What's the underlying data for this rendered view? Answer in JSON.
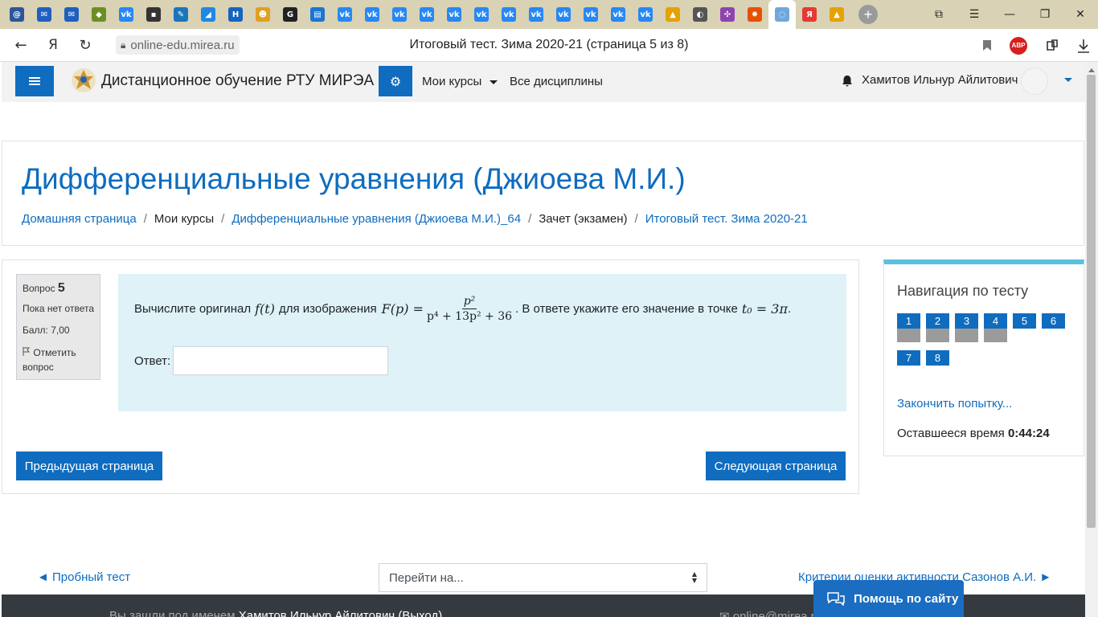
{
  "browser": {
    "tabs": [
      {
        "icon": "at-mail-icon",
        "color": "#2b579a",
        "glyph": "@"
      },
      {
        "icon": "mail-icon",
        "color": "#1f5fbf",
        "glyph": "✉"
      },
      {
        "icon": "mail-icon",
        "color": "#1f5fbf",
        "glyph": "✉"
      },
      {
        "icon": "emblem-icon",
        "color": "#6b8e23",
        "glyph": "◆"
      },
      {
        "icon": "vk-icon",
        "color": "#2787f5",
        "glyph": "vk"
      },
      {
        "icon": "app-icon",
        "color": "#333333",
        "glyph": "▪"
      },
      {
        "icon": "wrench-icon",
        "color": "#1b75bb",
        "glyph": "✎"
      },
      {
        "icon": "leaf-icon",
        "color": "#1e88e5",
        "glyph": "◢"
      },
      {
        "icon": "h-icon",
        "color": "#1565c0",
        "glyph": "H"
      },
      {
        "icon": "face-icon",
        "color": "#e0a020",
        "glyph": "☻"
      },
      {
        "icon": "g-icon",
        "color": "#222222",
        "glyph": "G"
      },
      {
        "icon": "chat-icon",
        "color": "#1976d2",
        "glyph": "▤"
      },
      {
        "icon": "vk-icon",
        "color": "#2787f5",
        "glyph": "vk"
      },
      {
        "icon": "vk-icon",
        "color": "#2787f5",
        "glyph": "vk"
      },
      {
        "icon": "vk-icon",
        "color": "#2787f5",
        "glyph": "vk"
      },
      {
        "icon": "vk-icon",
        "color": "#2787f5",
        "glyph": "vk"
      },
      {
        "icon": "vk-icon",
        "color": "#2787f5",
        "glyph": "vk"
      },
      {
        "icon": "vk-icon",
        "color": "#2787f5",
        "glyph": "vk"
      },
      {
        "icon": "vk-icon",
        "color": "#2787f5",
        "glyph": "vk"
      },
      {
        "icon": "vk-icon",
        "color": "#2787f5",
        "glyph": "vk"
      },
      {
        "icon": "vk-icon",
        "color": "#2787f5",
        "glyph": "vk"
      },
      {
        "icon": "vk-icon",
        "color": "#2787f5",
        "glyph": "vk"
      },
      {
        "icon": "vk-icon",
        "color": "#2787f5",
        "glyph": "vk"
      },
      {
        "icon": "vk-icon",
        "color": "#2787f5",
        "glyph": "vk"
      },
      {
        "icon": "image-icon",
        "color": "#e6a200",
        "glyph": "▲"
      },
      {
        "icon": "moodle-icon",
        "color": "#555555",
        "glyph": "◐"
      },
      {
        "icon": "grid-icon",
        "color": "#8e44ad",
        "glyph": "✣"
      },
      {
        "icon": "sun-icon",
        "color": "#e65100",
        "glyph": "✹"
      },
      {
        "icon": "active-tab-icon",
        "color": "#6fa8dc",
        "glyph": "◌"
      },
      {
        "icon": "yandex-icon",
        "color": "#e53935",
        "glyph": "Я"
      },
      {
        "icon": "image-icon",
        "color": "#e6a200",
        "glyph": "▲"
      }
    ],
    "url": "online-edu.mirea.ru",
    "page_title": "Итоговый тест. Зима 2020-21 (страница 5 из 8)",
    "abp_label": "ABP",
    "yandex_label": "Я"
  },
  "navbar": {
    "site_name": "Дистанционное обучение РТУ МИРЭА",
    "my_courses": "Мои курсы",
    "all_disciplines": "Все дисциплины",
    "user_name": "Хамитов Ильнур Айлитович"
  },
  "header": {
    "course_title": "Дифференциальные уравнения (Джиоева М.И.)",
    "breadcrumb": [
      {
        "label": "Домашняя страница",
        "link": true
      },
      {
        "label": "Мои курсы",
        "link": false
      },
      {
        "label": "Дифференциальные уравнения (Джиоева М.И.)_64",
        "link": true
      },
      {
        "label": "Зачет (экзамен)",
        "link": false
      },
      {
        "label": "Итоговый тест. Зима 2020-21",
        "link": true
      }
    ]
  },
  "question": {
    "label": "Вопрос",
    "number": "5",
    "state": "Пока нет ответа",
    "grade": "Балл: 7,00",
    "flag_line1": "Отметить",
    "flag_line2": "вопрос",
    "text_part1": "Вычислите оригинал",
    "math_ft": "f(t)",
    "text_part2": "для изображения",
    "math_Fp": "F(p) =",
    "frac_num": "p²",
    "frac_den": "p⁴ + 13p² + 36",
    "text_part3": ". В ответе укажите его значение в точке",
    "math_t0": "t₀ = 3π",
    "text_end": ".",
    "answer_label": "Ответ:",
    "answer_value": ""
  },
  "buttons": {
    "prev_page": "Предыдущая страница",
    "next_page": "Следующая страница"
  },
  "quiz_nav": {
    "title": "Навигация по тесту",
    "questions": [
      {
        "n": "1",
        "answered": true
      },
      {
        "n": "2",
        "answered": true
      },
      {
        "n": "3",
        "answered": true
      },
      {
        "n": "4",
        "answered": true
      },
      {
        "n": "5",
        "answered": false
      },
      {
        "n": "6",
        "answered": false
      },
      {
        "n": "7",
        "answered": false
      },
      {
        "n": "8",
        "answered": false
      }
    ],
    "finish_link": "Закончить попытку...",
    "time_label": "Оставшееся время",
    "time_value": "0:44:24"
  },
  "activity_nav": {
    "prev": "◄ Пробный тест",
    "jump_placeholder": "Перейти на...",
    "next": "Критерии оценки активности Сазонов А.И. ►"
  },
  "footer": {
    "logged_in_prefix": "Вы зашли под именем",
    "logged_in_user": "Хамитов Ильнур Айлитович",
    "logout": "(Выход)",
    "email": "online@mirea.ru"
  },
  "help": {
    "label": "Помощь по сайту"
  },
  "colors": {
    "accent": "#0f6cbf",
    "question_bg": "#def2f8",
    "nav_border": "#5bc0de",
    "footer_bg": "#343a40"
  }
}
